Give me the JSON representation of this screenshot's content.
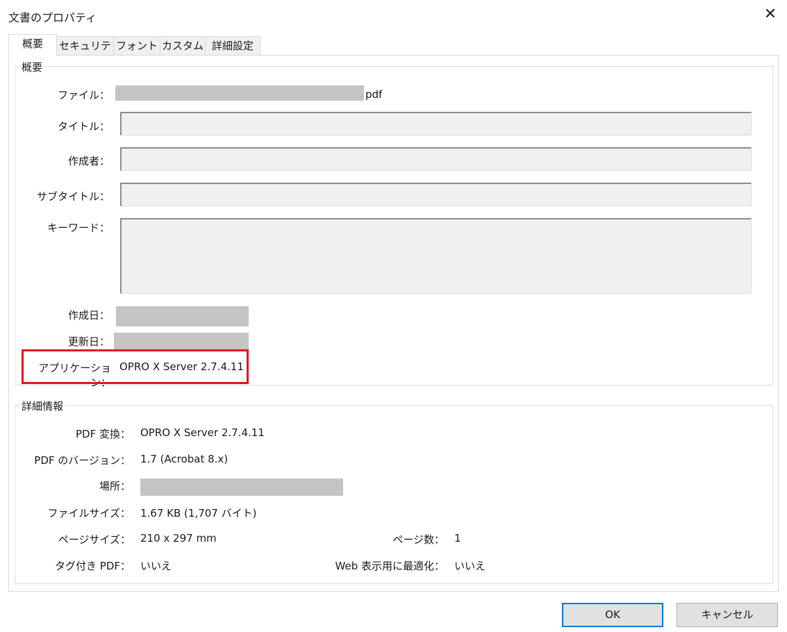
{
  "window": {
    "title": "文書のプロパティ",
    "close_glyph": "✕"
  },
  "tabs": [
    {
      "label": "概要",
      "active": true
    },
    {
      "label": "セキュリティ",
      "active": false
    },
    {
      "label": "フォント",
      "active": false
    },
    {
      "label": "カスタム",
      "active": false
    },
    {
      "label": "詳細設定",
      "active": false
    }
  ],
  "summary": {
    "legend": "概要",
    "file": {
      "label": "ファイル：",
      "suffix": "pdf"
    },
    "title": {
      "label": "タイトル：",
      "value": ""
    },
    "author": {
      "label": "作成者：",
      "value": ""
    },
    "subtitle": {
      "label": "サブタイトル：",
      "value": ""
    },
    "keywords": {
      "label": "キーワード：",
      "value": ""
    },
    "created": {
      "label": "作成日："
    },
    "modified": {
      "label": "更新日："
    },
    "application": {
      "label": "アプリケーション：",
      "value": "OPRO X Server 2.7.4.11"
    }
  },
  "details": {
    "legend": "詳細情報",
    "pdf_producer": {
      "label": "PDF 変換：",
      "value": "OPRO X Server 2.7.4.11"
    },
    "pdf_version": {
      "label": "PDF のバージョン：",
      "value": "1.7 (Acrobat 8.x)"
    },
    "location": {
      "label": "場所："
    },
    "file_size": {
      "label": "ファイルサイズ：",
      "value": "1.67 KB (1,707 バイト)"
    },
    "page_size": {
      "label": "ページサイズ：",
      "value": "210 x 297 mm"
    },
    "page_count": {
      "label": "ページ数：",
      "value": "1"
    },
    "tagged_pdf": {
      "label": "タグ付き PDF：",
      "value": "いいえ"
    },
    "fast_web_view": {
      "label": "Web 表示用に最適化：",
      "value": "いいえ"
    }
  },
  "buttons": {
    "ok": "OK",
    "cancel": "キャンセル"
  },
  "colors": {
    "highlight": "#e2151d",
    "accent": "#0078d7"
  }
}
